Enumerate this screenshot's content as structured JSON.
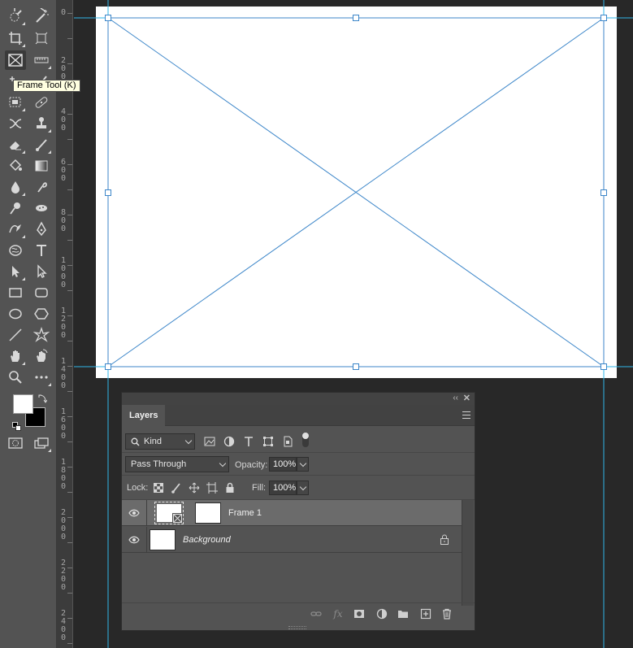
{
  "app": {
    "tooltip": "Frame Tool (K)"
  },
  "toolbar": {
    "tools_left": [
      "lasso-tool-icon",
      "crop-tool-icon",
      "frame-tool-icon",
      "spot-healing-icon",
      "object-selection-icon",
      "content-aware-move-icon",
      "eraser-icon",
      "paint-bucket-icon",
      "blur-icon",
      "dodge-icon",
      "pen-tool-icon",
      "sponge-like-icon",
      "path-selection-icon",
      "rectangle-tool-icon",
      "ellipse-tool-icon",
      "line-tool-icon",
      "hand-tool-icon",
      "zoom-tool-icon"
    ],
    "colors": {
      "foreground": "#ffffff",
      "background": "#000000"
    }
  },
  "ruler": {
    "labels": [
      "0",
      "2\n0\n0",
      "4\n0\n0",
      "6\n0\n0",
      "8\n0\n0",
      "1\n0\n0\n0",
      "1\n2\n0\n0",
      "1\n4\n0\n0",
      "1\n6\n0\n0",
      "1\n8\n0\n0",
      "2\n0\n0\n0",
      "2\n2\n0\n0",
      "2\n4\n0\n0"
    ]
  },
  "canvas": {
    "guide_color": "#2fb6e8",
    "frame_color": "#3c86c9"
  },
  "layers_panel": {
    "tab_label": "Layers",
    "filter_kind": "Kind",
    "blend_mode": "Pass Through",
    "opacity_label": "Opacity:",
    "opacity_value": "100%",
    "lock_label": "Lock:",
    "fill_label": "Fill:",
    "fill_value": "100%",
    "layers": [
      {
        "name": "Frame 1",
        "selected": true
      },
      {
        "name": "Background",
        "selected": false,
        "locked": true
      }
    ]
  }
}
